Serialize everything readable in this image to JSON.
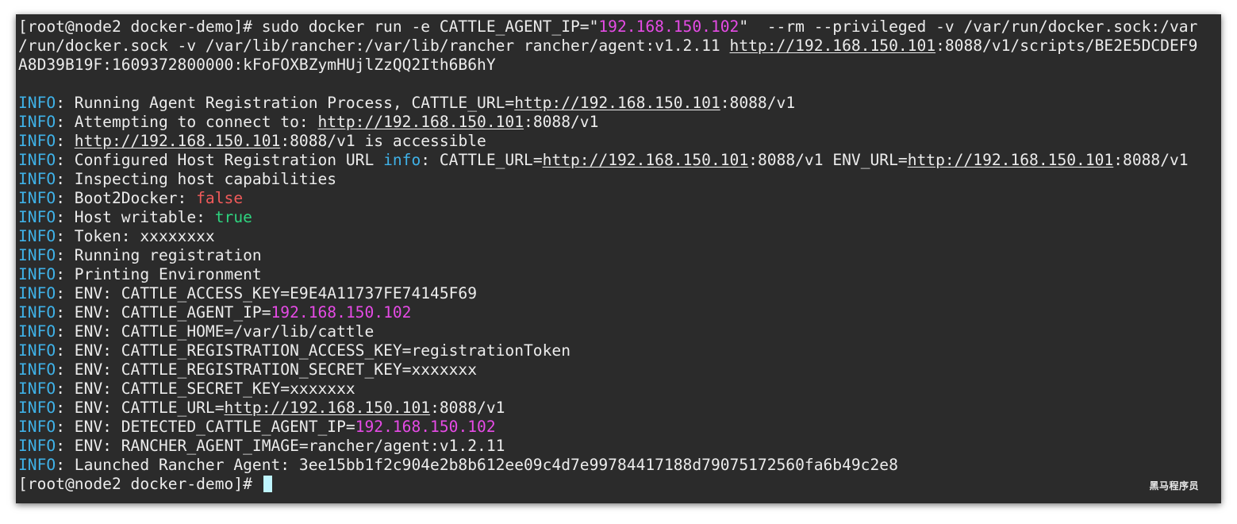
{
  "colors": {
    "background": "#2b2b2b",
    "text": "#ececec",
    "info": "#3fb2e8",
    "ip": "#e64be6",
    "false": "#f05a5a",
    "true": "#2ed47f",
    "cursor": "#bff5ff"
  },
  "terminal": {
    "lines": [
      [
        {
          "text": "[root@node2 docker-demo]# sudo docker run -e CATTLE_AGENT_IP=\""
        },
        {
          "text": "192.168.150.102",
          "color": "ip"
        },
        {
          "text": "\"  --rm --privileged -v /var/run/docker.sock:/var"
        }
      ],
      [
        {
          "text": "/run/docker.sock -v /var/lib/rancher:/var/lib/rancher rancher/agent:v1.2.11 "
        },
        {
          "text": "http://192.168.150.101",
          "link": true
        },
        {
          "text": ":8088/v1/scripts/BE2E5DCDEF9"
        }
      ],
      [
        {
          "text": "A8D39B19F:1609372800000:kFoFOXBZymHUjlZzQQ2Ith6B6hY"
        }
      ],
      [],
      [
        {
          "text": "INFO",
          "color": "info"
        },
        {
          "text": ": Running Agent Registration Process, CATTLE_URL="
        },
        {
          "text": "http://192.168.150.101",
          "link": true
        },
        {
          "text": ":8088/v1"
        }
      ],
      [
        {
          "text": "INFO",
          "color": "info"
        },
        {
          "text": ": Attempting to connect to: "
        },
        {
          "text": "http://192.168.150.101",
          "link": true
        },
        {
          "text": ":8088/v1"
        }
      ],
      [
        {
          "text": "INFO",
          "color": "info"
        },
        {
          "text": ": "
        },
        {
          "text": "http://192.168.150.101",
          "link": true
        },
        {
          "text": ":8088/v1 is accessible"
        }
      ],
      [
        {
          "text": "INFO",
          "color": "info"
        },
        {
          "text": ": Configured Host Registration URL "
        },
        {
          "text": "info",
          "color": "info"
        },
        {
          "text": ": CATTLE_URL="
        },
        {
          "text": "http://192.168.150.101",
          "link": true
        },
        {
          "text": ":8088/v1 ENV_URL="
        },
        {
          "text": "http://192.168.150.101",
          "link": true
        },
        {
          "text": ":8088/v1"
        }
      ],
      [
        {
          "text": "INFO",
          "color": "info"
        },
        {
          "text": ": Inspecting host capabilities"
        }
      ],
      [
        {
          "text": "INFO",
          "color": "info"
        },
        {
          "text": ": Boot2Docker: "
        },
        {
          "text": "false",
          "color": "false"
        }
      ],
      [
        {
          "text": "INFO",
          "color": "info"
        },
        {
          "text": ": Host writable: "
        },
        {
          "text": "true",
          "color": "true"
        }
      ],
      [
        {
          "text": "INFO",
          "color": "info"
        },
        {
          "text": ": Token: xxxxxxxx"
        }
      ],
      [
        {
          "text": "INFO",
          "color": "info"
        },
        {
          "text": ": Running registration"
        }
      ],
      [
        {
          "text": "INFO",
          "color": "info"
        },
        {
          "text": ": Printing Environment"
        }
      ],
      [
        {
          "text": "INFO",
          "color": "info"
        },
        {
          "text": ": ENV: CATTLE_ACCESS_KEY=E9E4A11737FE74145F69"
        }
      ],
      [
        {
          "text": "INFO",
          "color": "info"
        },
        {
          "text": ": ENV: CATTLE_AGENT_IP="
        },
        {
          "text": "192.168.150.102",
          "color": "ip"
        }
      ],
      [
        {
          "text": "INFO",
          "color": "info"
        },
        {
          "text": ": ENV: CATTLE_HOME=/var/lib/cattle"
        }
      ],
      [
        {
          "text": "INFO",
          "color": "info"
        },
        {
          "text": ": ENV: CATTLE_REGISTRATION_ACCESS_KEY=registrationToken"
        }
      ],
      [
        {
          "text": "INFO",
          "color": "info"
        },
        {
          "text": ": ENV: CATTLE_REGISTRATION_SECRET_KEY=xxxxxxx"
        }
      ],
      [
        {
          "text": "INFO",
          "color": "info"
        },
        {
          "text": ": ENV: CATTLE_SECRET_KEY=xxxxxxx"
        }
      ],
      [
        {
          "text": "INFO",
          "color": "info"
        },
        {
          "text": ": ENV: CATTLE_URL="
        },
        {
          "text": "http://192.168.150.101",
          "link": true
        },
        {
          "text": ":8088/v1"
        }
      ],
      [
        {
          "text": "INFO",
          "color": "info"
        },
        {
          "text": ": ENV: DETECTED_CATTLE_AGENT_IP="
        },
        {
          "text": "192.168.150.102",
          "color": "ip"
        }
      ],
      [
        {
          "text": "INFO",
          "color": "info"
        },
        {
          "text": ": ENV: RANCHER_AGENT_IMAGE=rancher/agent:v1.2.11"
        }
      ],
      [
        {
          "text": "INFO",
          "color": "info"
        },
        {
          "text": ": Launched Rancher Agent: 3ee15bb1f2c904e2b8b612ee09c4d7e99784417188d79075172560fa6b49c2e8"
        }
      ]
    ],
    "prompt": "[root@node2 docker-demo]# "
  },
  "watermark": "黑马程序员"
}
